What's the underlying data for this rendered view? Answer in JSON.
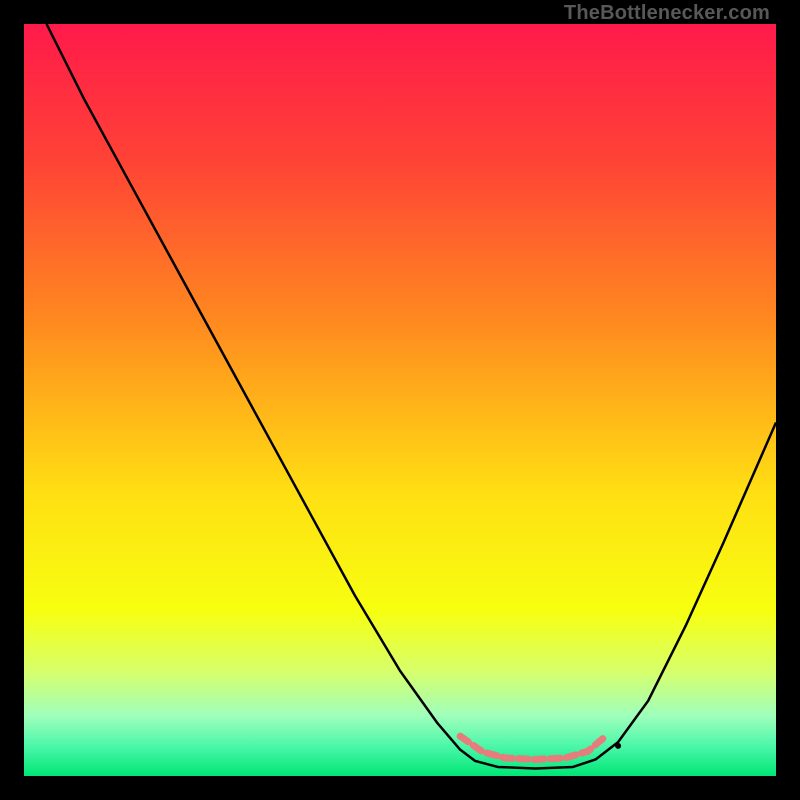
{
  "watermark": "TheBottlenecker.com",
  "chart_data": {
    "type": "line",
    "title": "",
    "xlabel": "",
    "ylabel": "",
    "xlim": [
      0,
      100
    ],
    "ylim": [
      0,
      100
    ],
    "gradient_colors": [
      {
        "stop": 0.0,
        "hex": "#ff1a4b"
      },
      {
        "stop": 0.18,
        "hex": "#ff4236"
      },
      {
        "stop": 0.4,
        "hex": "#ff8b1f"
      },
      {
        "stop": 0.62,
        "hex": "#ffde13"
      },
      {
        "stop": 0.78,
        "hex": "#f7ff10"
      },
      {
        "stop": 0.86,
        "hex": "#d7ff6a"
      },
      {
        "stop": 0.92,
        "hex": "#9fffbc"
      },
      {
        "stop": 0.96,
        "hex": "#4cf7a9"
      },
      {
        "stop": 1.0,
        "hex": "#00e676"
      }
    ],
    "curve_points": [
      {
        "x": 3.0,
        "y": 100.0
      },
      {
        "x": 8.0,
        "y": 90.0
      },
      {
        "x": 14.0,
        "y": 79.0
      },
      {
        "x": 20.0,
        "y": 68.0
      },
      {
        "x": 26.0,
        "y": 57.0
      },
      {
        "x": 32.0,
        "y": 46.0
      },
      {
        "x": 38.0,
        "y": 35.0
      },
      {
        "x": 44.0,
        "y": 24.0
      },
      {
        "x": 50.0,
        "y": 14.0
      },
      {
        "x": 55.0,
        "y": 7.0
      },
      {
        "x": 58.0,
        "y": 3.5
      },
      {
        "x": 60.0,
        "y": 2.0
      },
      {
        "x": 63.0,
        "y": 1.2
      },
      {
        "x": 68.0,
        "y": 1.0
      },
      {
        "x": 73.0,
        "y": 1.2
      },
      {
        "x": 76.0,
        "y": 2.2
      },
      {
        "x": 79.0,
        "y": 4.5
      },
      {
        "x": 83.0,
        "y": 10.0
      },
      {
        "x": 88.0,
        "y": 20.0
      },
      {
        "x": 93.0,
        "y": 31.0
      },
      {
        "x": 100.0,
        "y": 47.0
      }
    ],
    "flat_segment": {
      "color": "#e77c7c",
      "width": 7,
      "points": [
        {
          "x": 58.0,
          "y": 5.3
        },
        {
          "x": 61.0,
          "y": 3.2
        },
        {
          "x": 64.0,
          "y": 2.4
        },
        {
          "x": 68.0,
          "y": 2.2
        },
        {
          "x": 72.0,
          "y": 2.4
        },
        {
          "x": 75.0,
          "y": 3.3
        },
        {
          "x": 77.0,
          "y": 5.0
        }
      ]
    },
    "dot": {
      "x": 79.0,
      "y": 4.0,
      "r": 3,
      "color": "#000"
    }
  }
}
